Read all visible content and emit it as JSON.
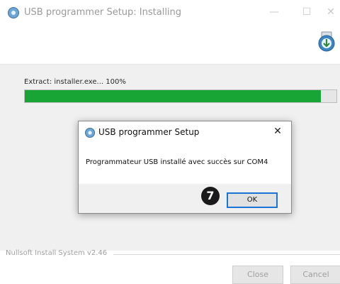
{
  "window": {
    "title": "USB programmer Setup: Installing",
    "title_icon": "installer-icon",
    "header_icon": "installer-download-icon",
    "min_glyph": "—",
    "max_glyph": "☐",
    "close_glyph": "✕"
  },
  "progress": {
    "status_text": "Extract: installer.exe... 100%",
    "value_percent": 100,
    "fill_fraction": 0.95,
    "fill_color": "#19a535"
  },
  "footer": {
    "branding": "Nullsoft Install System v2.46"
  },
  "buttons": {
    "close_label": "Close",
    "cancel_label": "Cancel"
  },
  "dialog": {
    "title": "USB programmer Setup",
    "close_glyph": "✕",
    "message": "Programmateur USB installé avec succès sur COM4",
    "badge": "7",
    "ok_label": "OK",
    "accent_color": "#1a73d6"
  }
}
